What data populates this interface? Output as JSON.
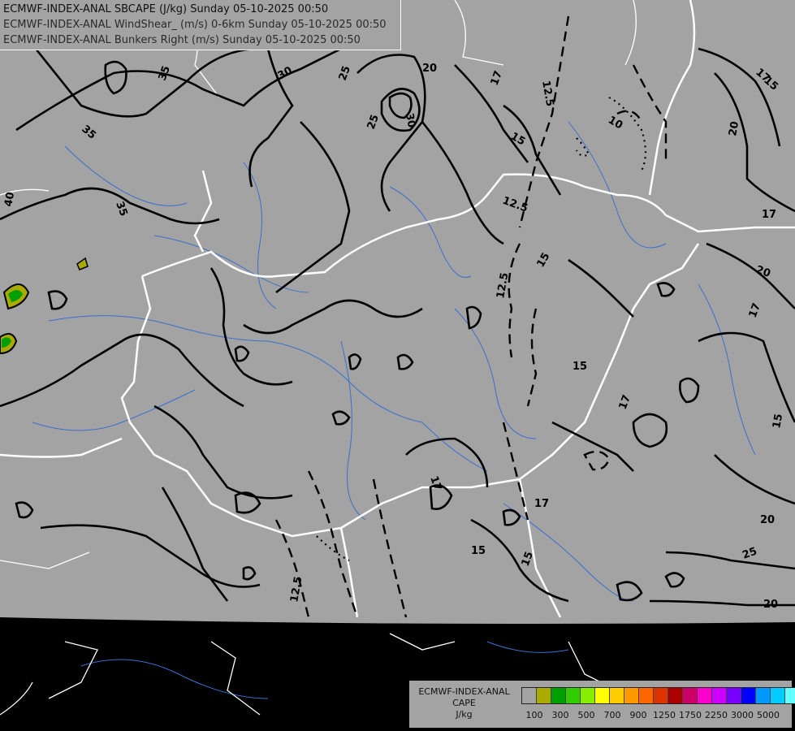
{
  "header": {
    "line1": "ECMWF-INDEX-ANAL SBCAPE (J/kg) Sunday 05-10-2025 00:50",
    "line2": "ECMWF-INDEX-ANAL WindShear_ (m/s) 0-6km Sunday 05-10-2025 00:50",
    "line3": "ECMWF-INDEX-ANAL Bunkers Right (m/s) Sunday 05-10-2025 00:50"
  },
  "legend": {
    "title_line1": "ECMWF-INDEX-ANAL",
    "title_line2": "CAPE",
    "title_line3": "J/kg",
    "colors": [
      "#a3a3a3",
      "#aaaa00",
      "#00a000",
      "#33cc00",
      "#88ee00",
      "#ffff00",
      "#ffcc00",
      "#ff9900",
      "#ff6600",
      "#dd3300",
      "#aa0000",
      "#cc0066",
      "#ff00cc",
      "#cc00ff",
      "#7700ff",
      "#0000ff",
      "#0099ff",
      "#00ccff",
      "#66ffff",
      "#ffffff"
    ],
    "ticks": [
      "100",
      "300",
      "500",
      "700",
      "900",
      "1250",
      "1750",
      "2250",
      "3000",
      "5000"
    ]
  },
  "colors": {
    "map_fill": "#a3a3a3",
    "background": "#000000",
    "border": "#ffffff",
    "river": "#3a6fd0",
    "contour": "#000000",
    "cape_low": "#aaaa00",
    "cape_mid": "#00a000"
  },
  "contour_labels": {
    "l35a": "35",
    "l30a": "30",
    "l25a": "25",
    "l25b": "25",
    "l20a": "20",
    "l17a": "17",
    "l15a": "15",
    "l35b": "35",
    "l35c": "35",
    "l40": "40",
    "l12a": "12.5",
    "l12b": "12.5",
    "l12c": "12.5",
    "l12d": "12.5",
    "l10": "10",
    "l15b": "15",
    "l17b": "17",
    "l15c": "15",
    "l15d": "15",
    "l17c": "17",
    "l17d": "17",
    "l17e": "17",
    "l17f": "17",
    "l20b": "20",
    "l20c": "20",
    "l15e": "15",
    "l15f": "15",
    "l15g": "15",
    "l20d": "20",
    "l25c": "25",
    "l20e": "20",
    "l30b": "30",
    "l15h": "15",
    "l20f": "20"
  }
}
